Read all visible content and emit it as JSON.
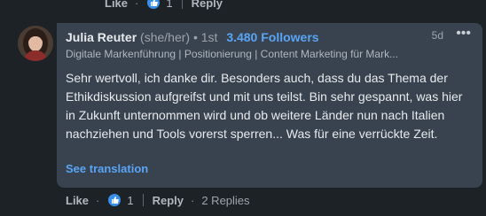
{
  "previous_actions": {
    "like_label": "Like",
    "reaction_count": "1",
    "reply_label": "Reply"
  },
  "comment": {
    "author_name": "Julia Reuter",
    "pronouns": "(she/her)",
    "connection_degree": "• 1st",
    "followers": "3.480 Followers",
    "headline": "Digitale Markenführung | Positionierung | Content Marketing für Mark...",
    "time_ago": "5d",
    "more_label": "•••",
    "text": "Sehr wertvoll, ich danke dir. Besonders auch, dass du das Thema der Ethikdiskussion aufgreifst und mit uns teilst. Bin sehr gespannt, was hier in Zukunft unternommen wird und ob weitere Länder nun nach Italien nachziehen und Tools vorerst sperren... Was für eine verrückte Zeit.",
    "see_translation": "See translation"
  },
  "actions": {
    "like_label": "Like",
    "reaction_count": "1",
    "reply_label": "Reply",
    "replies_label": "2 Replies"
  },
  "colors": {
    "accent": "#5aa4f5",
    "bubble": "#38434f",
    "background": "#1d2226"
  }
}
